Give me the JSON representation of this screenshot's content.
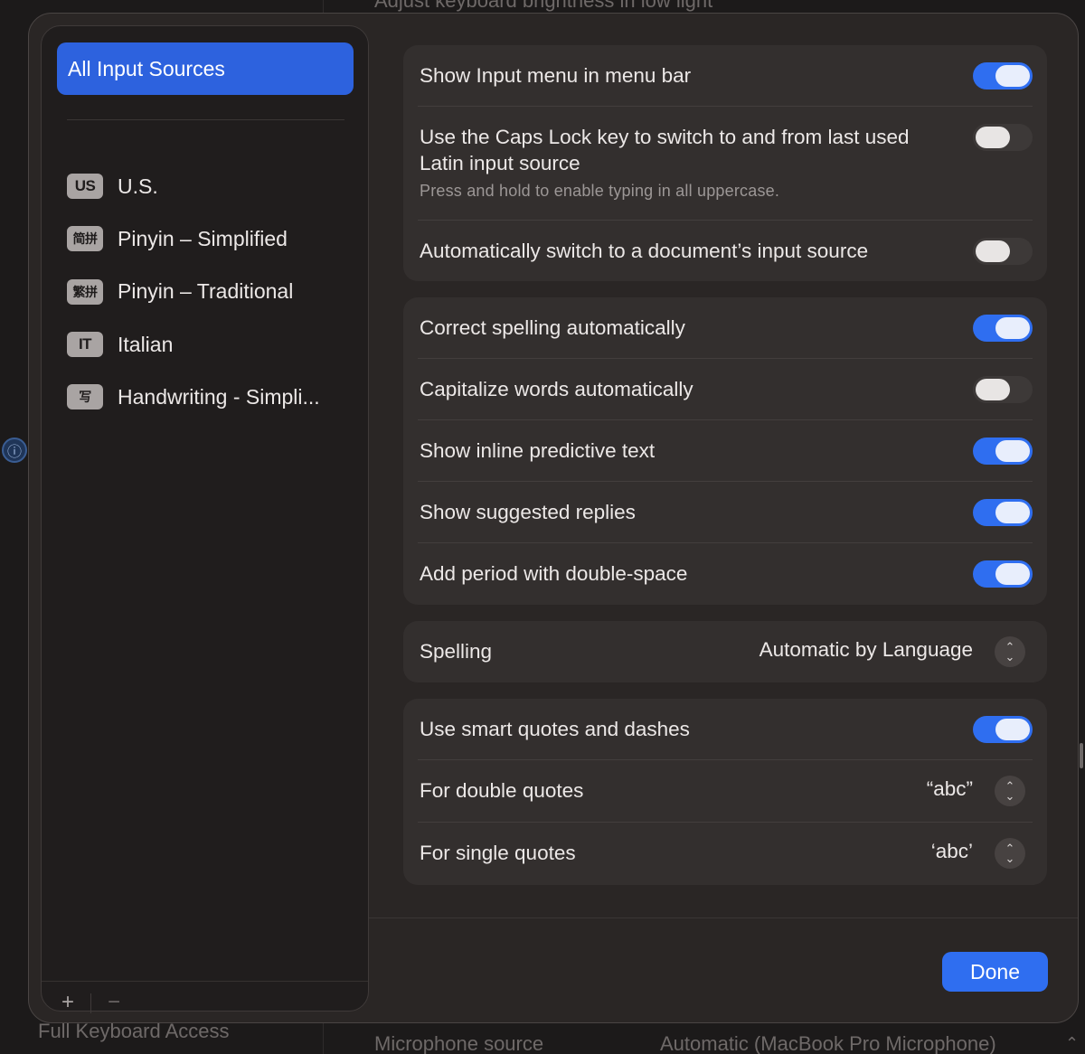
{
  "background": {
    "top_text": "Adjust keyboard brightness in low light",
    "bottom_left_text": "Full Keyboard Access",
    "bottom_mic_label": "Microphone source",
    "bottom_mic_value": "Automatic (MacBook Pro Microphone)"
  },
  "sidebar": {
    "selected_label": "All Input Sources",
    "sources": [
      {
        "badge": "US",
        "label": "U.S.",
        "icon": "us-flag-badge-icon"
      },
      {
        "badge": "简拼",
        "label": "Pinyin – Simplified",
        "icon": "pinyin-simplified-icon"
      },
      {
        "badge": "繁拼",
        "label": "Pinyin – Traditional",
        "icon": "pinyin-traditional-icon"
      },
      {
        "badge": "IT",
        "label": "Italian",
        "icon": "italian-badge-icon"
      },
      {
        "badge": "写",
        "label": "Handwriting - Simpli...",
        "icon": "handwriting-icon"
      }
    ],
    "add_label": "+",
    "remove_label": "−"
  },
  "settings": {
    "input_menu": {
      "label": "Show Input menu in menu bar",
      "on": true
    },
    "caps_lock": {
      "label": "Use the Caps Lock key to switch to and from last used Latin input source",
      "sub": "Press and hold to enable typing in all uppercase.",
      "on": false
    },
    "auto_switch": {
      "label": "Automatically switch to a document’s input source",
      "on": false
    },
    "correct_spelling": {
      "label": "Correct spelling automatically",
      "on": true
    },
    "capitalize": {
      "label": "Capitalize words automatically",
      "on": false
    },
    "inline_predictive": {
      "label": "Show inline predictive text",
      "on": true
    },
    "suggested_replies": {
      "label": "Show suggested replies",
      "on": true
    },
    "double_space": {
      "label": "Add period with double-space",
      "on": true
    },
    "spelling": {
      "label": "Spelling",
      "value": "Automatic by Language"
    },
    "smart_quotes": {
      "label": "Use smart quotes and dashes",
      "on": true
    },
    "double_quotes": {
      "label": "For double quotes",
      "value": "“abc”"
    },
    "single_quotes": {
      "label": "For single quotes",
      "value": "‘abc’"
    }
  },
  "done_label": "Done",
  "colors": {
    "accent": "#2f6ef0",
    "selection": "#2d62de"
  }
}
